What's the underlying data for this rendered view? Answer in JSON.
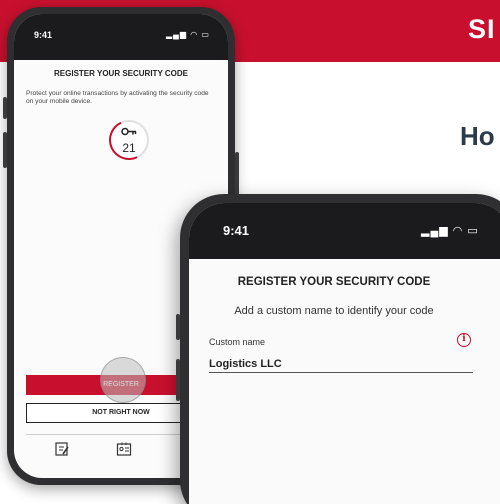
{
  "banner": {
    "title": "SI"
  },
  "subheading": "Ho",
  "back_phone": {
    "status_time": "9:41",
    "status_icons": "▂▄▆ ◠ ▭",
    "title": "REGISTER YOUR SECURITY CODE",
    "description": "Protect your online transactions by activating the security code on your mobile device.",
    "timer": {
      "icon": "key-icon",
      "count": "21"
    },
    "register_label": "REGISTER",
    "not_now_label": "NOT RIGHT NOW",
    "nav_icons": [
      "edit-document-icon",
      "id-card-icon",
      "lock-icon"
    ]
  },
  "front_phone": {
    "status_time": "9:41",
    "status_icons": "▂▄▆ ◠ ▭",
    "title": "REGISTER YOUR SECURITY CODE",
    "subtitle": "Add a custom name to identify your code",
    "field_label": "Custom name",
    "field_value": "Logistics LLC",
    "info_icon": "info-icon"
  },
  "colors": {
    "brand_red": "#c8102e",
    "phone_frame": "#2f2f31",
    "status_bar": "#1b1b1d"
  }
}
